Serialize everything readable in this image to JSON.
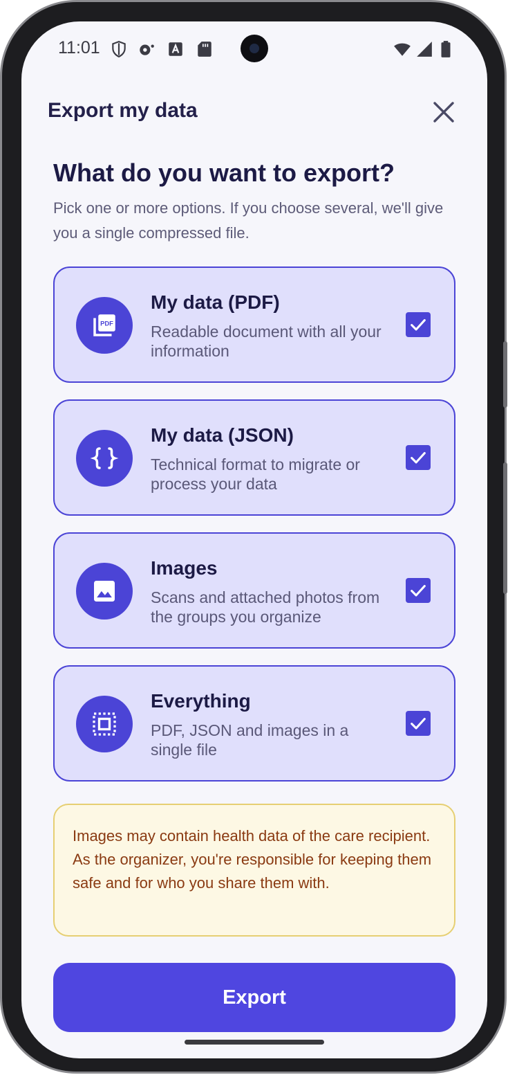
{
  "status_bar": {
    "time": "11:01"
  },
  "header": {
    "title": "Export my data",
    "close_icon": "close-icon"
  },
  "main": {
    "heading": "What do you want to export?",
    "subtext": "Pick one or more options. If you choose several, we'll give you a single compressed file."
  },
  "options": [
    {
      "title": "My data (PDF)",
      "description": "Readable document with all your information",
      "icon": "pdf-icon",
      "checked": true
    },
    {
      "title": "My data (JSON)",
      "description": "Technical format to migrate or process your data",
      "icon": "braces-icon",
      "checked": true
    },
    {
      "title": "Images",
      "description": "Scans and attached photos from the groups you organize",
      "icon": "image-icon",
      "checked": true
    },
    {
      "title": "Everything",
      "description": "PDF, JSON and images in a single file",
      "icon": "select-all-icon",
      "checked": true
    }
  ],
  "warning": {
    "text": "Images may contain health data of the care recipient. As the organizer, you're responsible for keeping them safe and for who you share them with."
  },
  "actions": {
    "export_label": "Export"
  },
  "colors": {
    "accent": "#4f46e0",
    "card_bg": "#e0dffc",
    "warning_bg": "#fdf8e4",
    "warning_text": "#8a3a12"
  }
}
